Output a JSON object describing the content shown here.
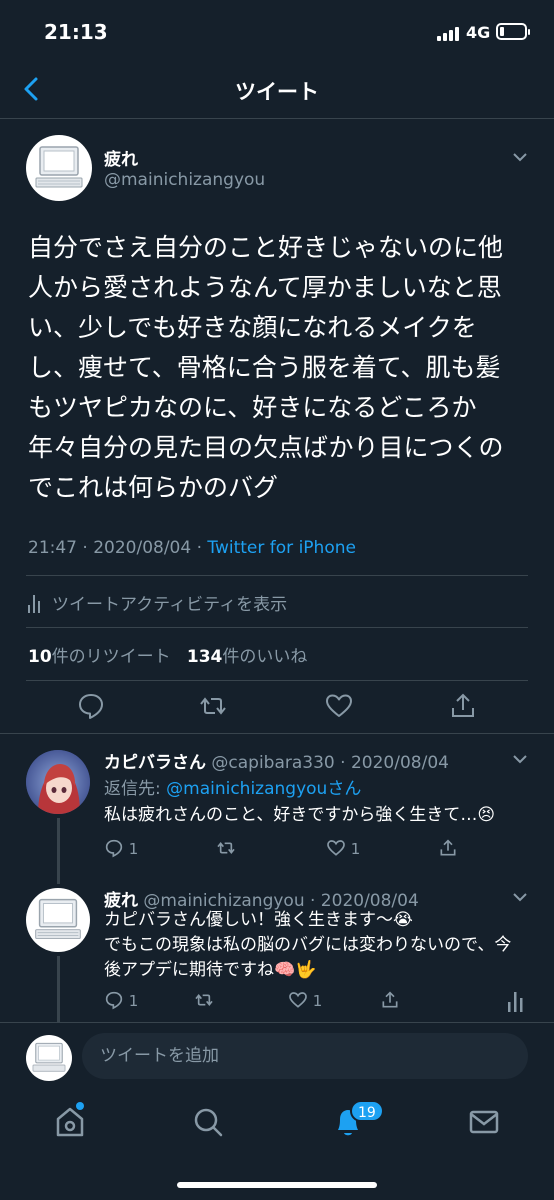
{
  "status": {
    "time": "21:13",
    "network": "4G"
  },
  "nav": {
    "title": "ツイート"
  },
  "tweet": {
    "name": "疲れ",
    "handle": "@mainichizangyou",
    "text": "自分でさえ自分のこと好きじゃないのに他\n人から愛されようなんて厚かましいなと思\nい、少しでも好きな顔になれるメイクを\nし、痩せて、骨格に合う服を着て、肌も髪\nもツヤピカなのに、好きになるどころか\n年々自分の見た目の欠点ばかり目につくの\nでこれは何らかのバグ",
    "time": "21:47 · 2020/08/04 · ",
    "source": "Twitter for iPhone",
    "activity_label": "ツイートアクティビティを表示",
    "retweet_count": "10",
    "retweet_label": "件のリツイート",
    "like_count": "134",
    "like_label": "件のいいね"
  },
  "replies": [
    {
      "name": "カピバラさん",
      "handle": "@capibara330",
      "date": "· 2020/08/04",
      "reply_to_label": "返信先: ",
      "reply_to_handle": "@mainichizangyouさん",
      "text": "私は疲れさんのこと、好きですから強く生きて…😣",
      "reply_count": "1",
      "like_count": "1"
    },
    {
      "name": "疲れ",
      "handle": "@mainichizangyou",
      "date": "· 2020/08/04",
      "text": "カピバラさん優しい！強く生きます〜😭\nでもこの現象は私の脳のバグには変わりないので、今\n後アプデに期待ですね🧠🤟",
      "reply_count": "1",
      "like_count": "1"
    }
  ],
  "compose": {
    "placeholder": "ツイートを追加"
  },
  "tabbar": {
    "notification_count": "19"
  },
  "colors": {
    "background": "#15202b",
    "accent": "#1da1f2",
    "muted": "#8899a6",
    "divider": "#38444d"
  }
}
